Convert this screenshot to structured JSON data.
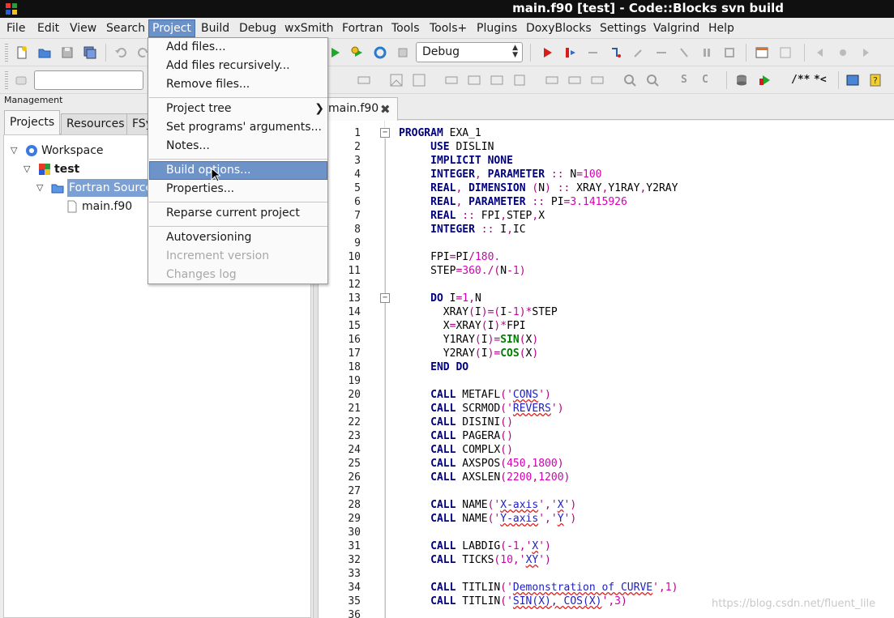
{
  "window": {
    "title": "main.f90 [test] - Code::Blocks svn build"
  },
  "menubar": {
    "items": [
      "File",
      "Edit",
      "View",
      "Search",
      "Project",
      "Build",
      "Debug",
      "wxSmith",
      "Fortran",
      "Tools",
      "Tools+",
      "Plugins",
      "DoxyBlocks",
      "Settings",
      "Valgrind",
      "Help"
    ],
    "active": "Project"
  },
  "toolbar": {
    "build_target": "Debug",
    "comment_block_label": "/**",
    "comment_line_label": "*<"
  },
  "project_menu": {
    "items": [
      {
        "label": "Add files...",
        "state": "normal"
      },
      {
        "label": "Add files recursively...",
        "state": "normal"
      },
      {
        "label": "Remove files...",
        "state": "normal"
      },
      {
        "label": "Project tree",
        "state": "submenu"
      },
      {
        "label": "Set programs' arguments...",
        "state": "normal"
      },
      {
        "label": "Notes...",
        "state": "normal"
      },
      {
        "label": "Build options...",
        "state": "highlighted"
      },
      {
        "label": "Properties...",
        "state": "normal"
      },
      {
        "label": "Reparse current project",
        "state": "normal"
      },
      {
        "label": "Autoversioning",
        "state": "normal"
      },
      {
        "label": "Increment version",
        "state": "disabled"
      },
      {
        "label": "Changes log",
        "state": "disabled"
      }
    ]
  },
  "management": {
    "title": "Management",
    "tabs": [
      "Projects",
      "Resources",
      "FSy"
    ],
    "active_tab": "Projects",
    "tree": [
      {
        "label": "Workspace",
        "icon": "workspace-icon",
        "expanded": true
      },
      {
        "label": "test",
        "icon": "project-icon",
        "expanded": true
      },
      {
        "label": "Fortran Sources",
        "icon": "folder-open-icon",
        "expanded": true,
        "selected": true
      },
      {
        "label": "main.f90",
        "icon": "file-icon"
      }
    ]
  },
  "editor": {
    "tab_label": "main.f90",
    "line_numbers": [
      "1",
      "2",
      "3",
      "4",
      "5",
      "6",
      "7",
      "8",
      "9",
      "10",
      "11",
      "12",
      "13",
      "14",
      "15",
      "16",
      "17",
      "18",
      "19",
      "20",
      "21",
      "22",
      "23",
      "24",
      "25",
      "26",
      "27",
      "28",
      "29",
      "30",
      "31",
      "32",
      "33",
      "34",
      "35",
      "36"
    ],
    "code_lines": [
      "PROGRAM EXA_1",
      "     USE DISLIN",
      "     IMPLICIT NONE",
      "     INTEGER, PARAMETER :: N=100",
      "     REAL, DIMENSION (N) :: XRAY,Y1RAY,Y2RAY",
      "     REAL, PARAMETER :: PI=3.1415926",
      "     REAL :: FPI,STEP,X",
      "     INTEGER :: I,IC",
      "",
      "     FPI=PI/180.",
      "     STEP=360./(N-1)",
      "",
      "     DO I=1,N",
      "       XRAY(I)=(I-1)*STEP",
      "       X=XRAY(I)*FPI",
      "       Y1RAY(I)=SIN(X)",
      "       Y2RAY(I)=COS(X)",
      "     END DO",
      "",
      "     CALL METAFL('CONS')",
      "     CALL SCRMOD('REVERS')",
      "     CALL DISINI()",
      "     CALL PAGERA()",
      "     CALL COMPLX()",
      "     CALL AXSPOS(450,1800)",
      "     CALL AXSLEN(2200,1200)",
      "",
      "     CALL NAME('X-axis','X')",
      "     CALL NAME('Y-axis','Y')",
      "",
      "     CALL LABDIG(-1,'X')",
      "     CALL TICKS(10,'XY')",
      "",
      "     CALL TITLIN('Demonstration of CURVE',1)",
      "     CALL TITLIN('SIN(X), COS(X)',3)",
      ""
    ]
  },
  "watermark": "https://blog.csdn.net/fluent_lile"
}
